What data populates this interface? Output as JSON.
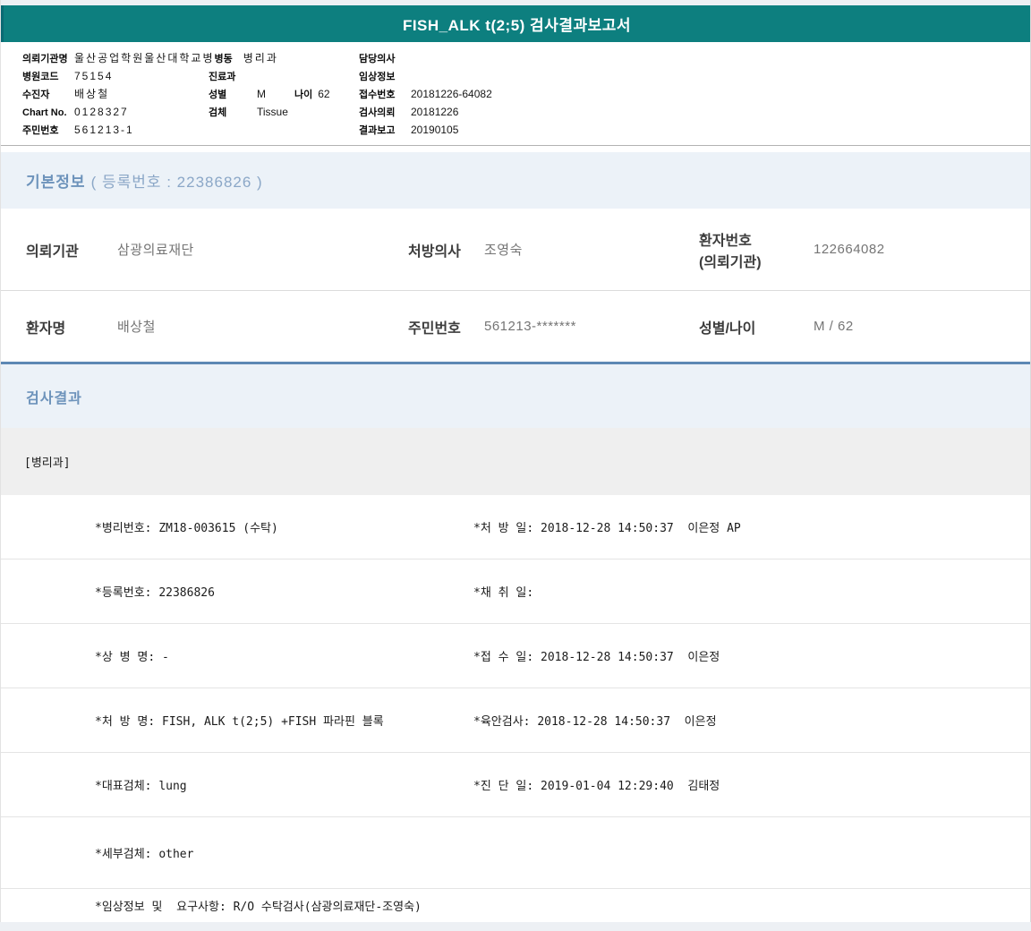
{
  "colors": {
    "teal": "#0d7f7f",
    "section-bg": "#ecf2f8",
    "section-title": "#6d93bb",
    "section-border": "#5d88b4",
    "dept-bg": "#efefef",
    "page-bg": "#edf0f4"
  },
  "title": "FISH_ALK t(2;5) 검사결과보고서",
  "report_header": {
    "left_rows": [
      {
        "label": "의뢰기관명",
        "value": "울산공업학원울산대학교병",
        "label2": "병동",
        "value2": "병리과"
      },
      {
        "label": "병원코드",
        "value": "75154",
        "label2": "진료과",
        "value2": ""
      },
      {
        "label": "수진자",
        "value": "배상철",
        "label2": "성별",
        "value2": "M",
        "label3": "나이",
        "value3": "62"
      },
      {
        "label": "Chart No.",
        "value": "0128327",
        "label2": "검체",
        "value2": "Tissue"
      },
      {
        "label": "주민번호",
        "value": "561213-1"
      }
    ],
    "right_rows": [
      {
        "label": "담당의사",
        "value": ""
      },
      {
        "label": "임상정보",
        "value": ""
      },
      {
        "label": "접수번호",
        "value": "20181226-64082"
      },
      {
        "label": "검사의뢰",
        "value": "20181226"
      },
      {
        "label": "결과보고",
        "value": "20190105"
      }
    ]
  },
  "basic_info": {
    "title": "기본정보",
    "title_sub": "( 등록번호 : 22386826 )",
    "row1": {
      "c1_label": "의뢰기관",
      "c1_value": "삼광의료재단",
      "c2_label": "처방의사",
      "c2_value": "조영숙",
      "c3_label_line1": "환자번호",
      "c3_label_line2": "(의뢰기관)",
      "c3_value": "122664082"
    },
    "row2": {
      "c1_label": "환자명",
      "c1_value": "배상철",
      "c2_label": "주민번호",
      "c2_value": "561213-*******",
      "c3_label": "성별/나이",
      "c3_value": "M / 62"
    }
  },
  "results": {
    "title": "검사결과",
    "department": "[병리과]",
    "rows": [
      {
        "left": "*병리번호: ZM18-003615 (수탁)",
        "right": "*처 방 일: 2018-12-28 14:50:37  이은정 AP"
      },
      {
        "left": "*등록번호: 22386826",
        "right": "*채 취 일:"
      },
      {
        "left": "*상 병 명: -",
        "right": "*접 수 일: 2018-12-28 14:50:37  이은정"
      },
      {
        "left": "*처 방 명: FISH, ALK t(2;5) +FISH 파라핀 블록",
        "right": "*육안검사: 2018-12-28 14:50:37  이은정"
      },
      {
        "left": "*대표검체: lung",
        "right": "*진 단 일: 2019-01-04 12:29:40  김태정"
      },
      {
        "left": "*세부검체: other",
        "right": ""
      },
      {
        "left": "*임상정보 및  요구사항: R/O 수탁검사(삼광의료재단-조영숙)",
        "right": ""
      }
    ]
  }
}
